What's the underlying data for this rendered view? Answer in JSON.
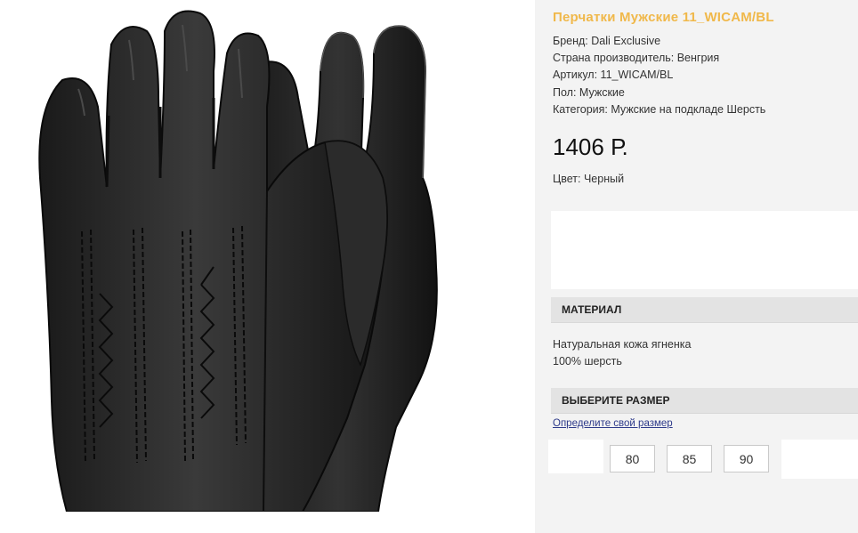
{
  "product": {
    "title": "Перчатки Мужские 11_WICAM/BL",
    "specs": [
      "Бренд: Dali Exclusive",
      "Страна производитель: Венгрия",
      "Артикул: 11_WICAM/BL",
      "Пол: Мужские",
      "Категория: Мужские на подкладе Шерсть"
    ],
    "price": "1406 Р.",
    "color": "Цвет: Черный",
    "image_icon": "gloves-photo"
  },
  "material": {
    "header": "МАТЕРИАЛ",
    "lines": [
      "Натуральная кожа ягненка",
      "100% шерсть"
    ]
  },
  "size": {
    "header": "ВЫБЕРИТЕ РАЗМЕР",
    "guide_link": "Определите свой размер",
    "options": [
      "80",
      "85",
      "90"
    ]
  },
  "colors": {
    "title_accent": "#f0b84a",
    "panel_bg": "#f3f3f3",
    "header_bg": "#e3e3e3",
    "link": "#2d3a8a"
  }
}
